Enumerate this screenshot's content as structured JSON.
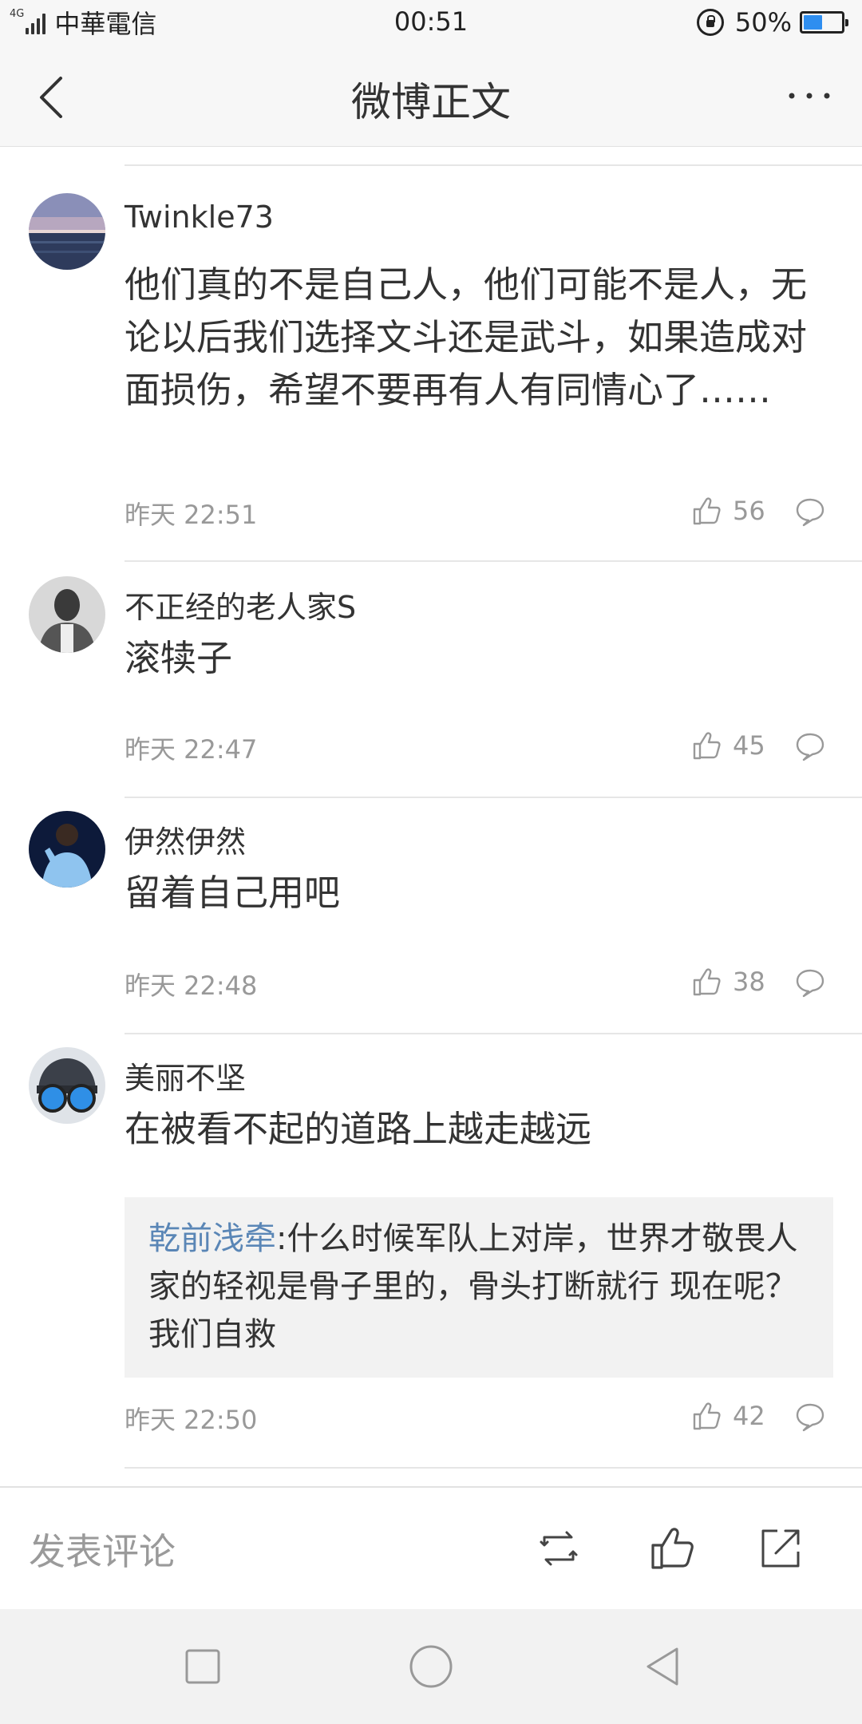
{
  "status_bar": {
    "network": "4G",
    "carrier": "中華電信",
    "time": "00:51",
    "battery_percent": "50%",
    "battery_level": 0.5,
    "battery_color": "#2e8ef0"
  },
  "nav": {
    "title": "微博正文",
    "back_icon": "chevron-left-icon",
    "more_icon": "more-horizontal-icon"
  },
  "comments": [
    {
      "user": "Twinkle73",
      "avatar": "sea-sunset-avatar",
      "text": "他们真的不是自己人，他们可能不是人，无论以后我们选择文斗还是武斗，如果造成对面损伤，希望不要再有人有同情心了……",
      "time": "昨天 22:51",
      "likes": "56"
    },
    {
      "user": "不正经的老人家S",
      "avatar": "bw-portrait-avatar",
      "text": "滚犊子",
      "time": "昨天 22:47",
      "likes": "45"
    },
    {
      "user": "伊然伊然",
      "avatar": "singer-avatar",
      "text": "留着自己用吧",
      "time": "昨天 22:48",
      "likes": "38"
    },
    {
      "user": "美丽不坚",
      "avatar": "helmet-avatar",
      "text": "在被看不起的道路上越走越远",
      "quote_author": "乾前浅牵",
      "quote_text": ":什么时候军队上对岸，世界才敬畏人家的轻视是骨子里的，骨头打断就行 现在呢？我们自救",
      "time": "昨天 22:50",
      "likes": "42"
    }
  ],
  "action_bar": {
    "placeholder": "发表评论",
    "icons": [
      "repost-icon",
      "like-icon",
      "share-icon"
    ]
  },
  "system_nav": {
    "icons": [
      "recents-square-icon",
      "home-circle-icon",
      "back-triangle-icon"
    ]
  },
  "colors": {
    "link_blue": "#5a86b6",
    "muted_text": "#999999",
    "divider": "#e6e6e6"
  }
}
